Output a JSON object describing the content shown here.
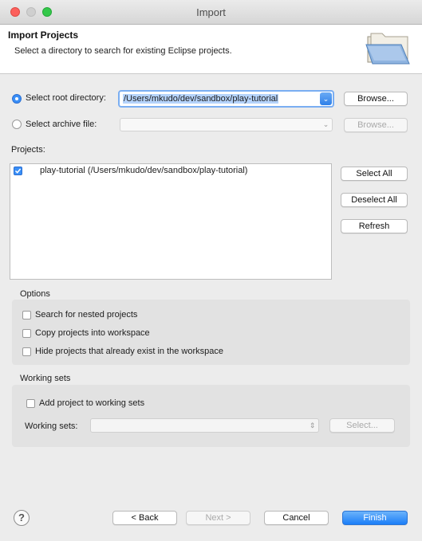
{
  "window": {
    "title": "Import",
    "traffic_colors": [
      "#fc605c",
      "#cfcfcf",
      "#34c84a"
    ]
  },
  "header": {
    "title": "Import Projects",
    "description": "Select a directory to search for existing Eclipse projects."
  },
  "source": {
    "root_label": "Select root directory:",
    "root_value": "/Users/mkudo/dev/sandbox/play-tutorial",
    "root_browse": "Browse...",
    "archive_label": "Select archive file:",
    "archive_value": "",
    "archive_browse": "Browse...",
    "selected": "root"
  },
  "projects": {
    "label": "Projects:",
    "items": [
      {
        "label": "play-tutorial (/Users/mkudo/dev/sandbox/play-tutorial)",
        "checked": true
      }
    ],
    "select_all": "Select All",
    "deselect_all": "Deselect All",
    "refresh": "Refresh"
  },
  "options": {
    "label": "Options",
    "items": [
      "Search for nested projects",
      "Copy projects into workspace",
      "Hide projects that already exist in the workspace"
    ]
  },
  "working_sets": {
    "label": "Working sets",
    "add_label": "Add project to working sets",
    "sets_label": "Working sets:",
    "sets_value": "",
    "select_button": "Select..."
  },
  "footer": {
    "help": "?",
    "back": "< Back",
    "next": "Next >",
    "cancel": "Cancel",
    "finish": "Finish"
  },
  "colors": {
    "accent": "#1b7ef8",
    "check": "#3a8ff7"
  }
}
